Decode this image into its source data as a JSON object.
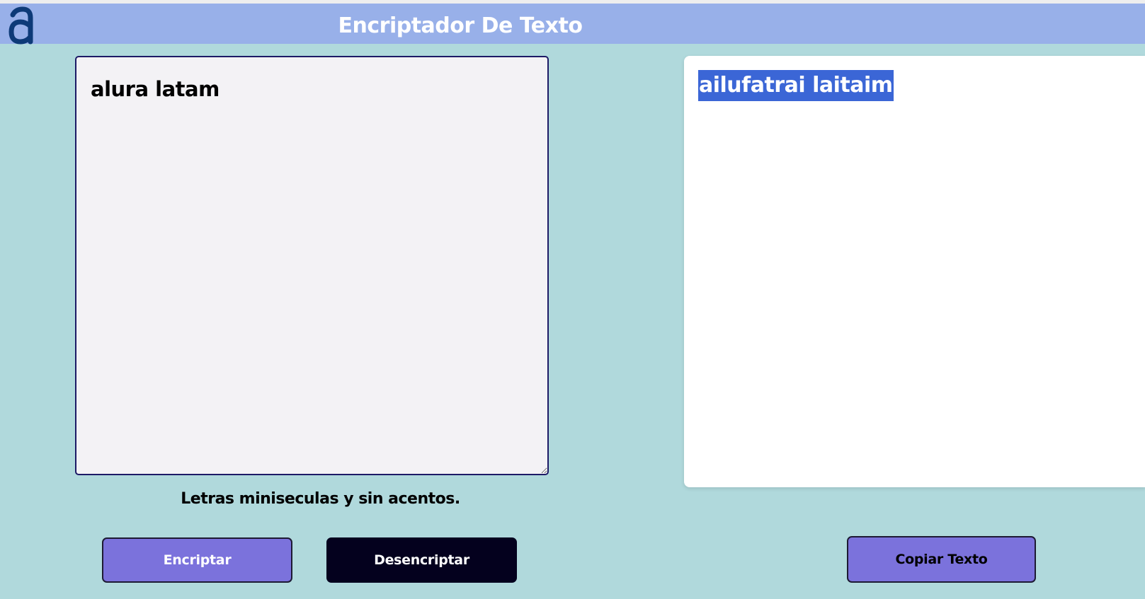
{
  "header": {
    "logo_icon": "alura-a-logo-icon",
    "title": "Encriptador De Texto"
  },
  "input": {
    "value": "alura latam"
  },
  "hint": "Letras miniseculas y sin acentos.",
  "output": {
    "value": "ailufatrai laitaim"
  },
  "buttons": {
    "encrypt": "Encriptar",
    "decrypt": "Desencriptar",
    "copy": "Copiar Texto"
  },
  "colors": {
    "background": "#b0d9dc",
    "header": "#98b0e9",
    "primary_button": "#7b72dc",
    "dark_button": "#04011e",
    "selection": "#3b66d6",
    "textarea_border": "#1d1a66"
  }
}
